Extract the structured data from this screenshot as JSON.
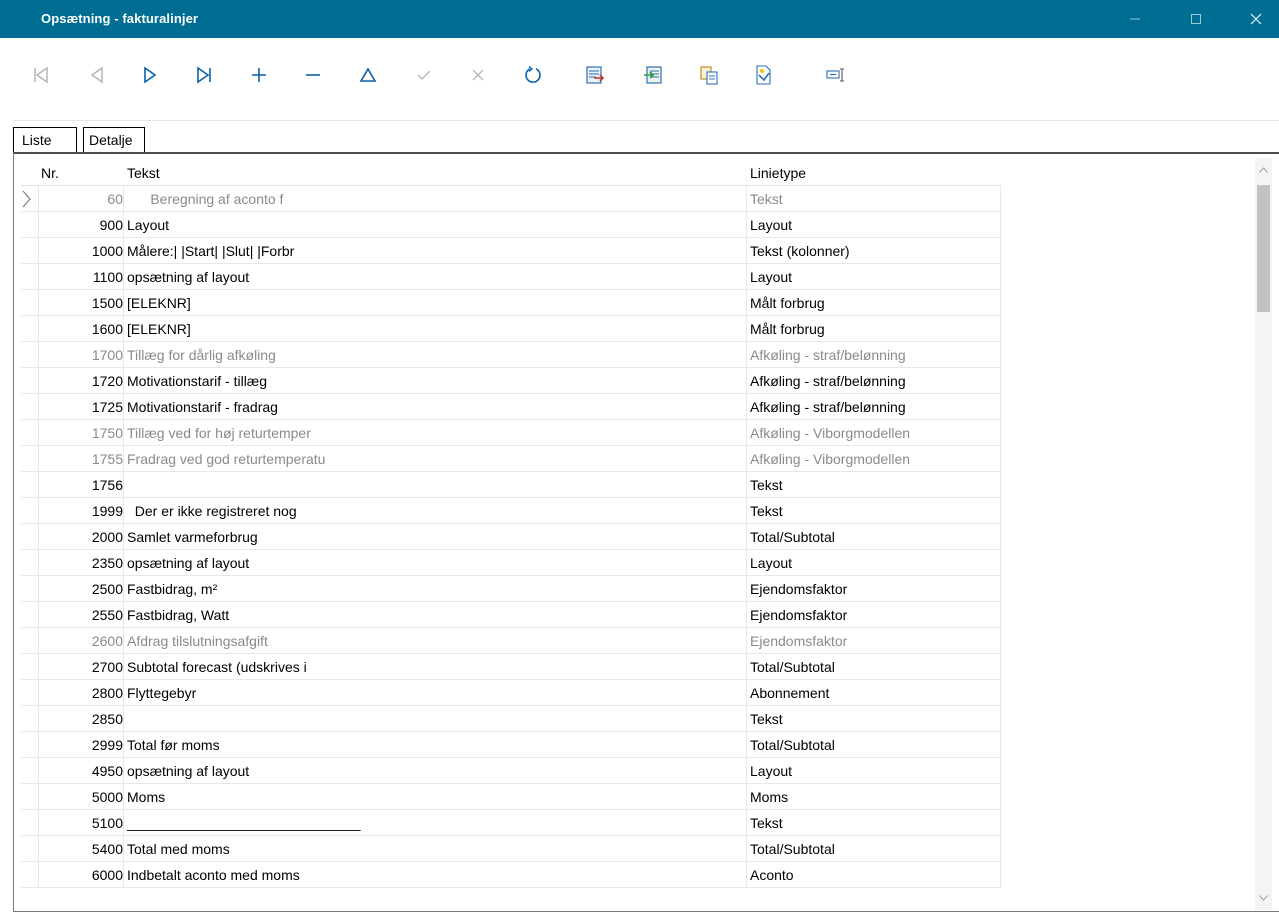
{
  "window": {
    "title": "Opsætning - fakturalinjer",
    "minimize": "—",
    "maximize": "☐",
    "close": "✕"
  },
  "toolbar": {
    "buttons": [
      {
        "name": "first-record",
        "icon": "first-icon",
        "enabled": false
      },
      {
        "name": "prior-record",
        "icon": "prior-icon",
        "enabled": false
      },
      {
        "name": "next-record",
        "icon": "next-icon",
        "enabled": true
      },
      {
        "name": "last-record",
        "icon": "last-icon",
        "enabled": true
      },
      {
        "name": "insert-record",
        "icon": "plus-icon",
        "enabled": true
      },
      {
        "name": "delete-record",
        "icon": "minus-icon",
        "enabled": true
      },
      {
        "name": "edit-record",
        "icon": "triangle-icon",
        "enabled": true
      },
      {
        "name": "post-edit",
        "icon": "check-icon",
        "enabled": false
      },
      {
        "name": "cancel-edit",
        "icon": "x-icon",
        "enabled": false
      },
      {
        "name": "refresh",
        "icon": "refresh-icon",
        "enabled": true
      },
      {
        "name": "export",
        "icon": "export-icon",
        "enabled": true
      },
      {
        "name": "import",
        "icon": "import-icon",
        "enabled": true
      },
      {
        "name": "copy",
        "icon": "copy-icon",
        "enabled": true
      },
      {
        "name": "edit-document",
        "icon": "document-edit-icon",
        "enabled": true
      },
      {
        "name": "field-chooser",
        "icon": "columns-icon",
        "enabled": true
      }
    ]
  },
  "tabs": [
    {
      "label": "Liste",
      "active": true
    },
    {
      "label": "Detalje",
      "active": false
    }
  ],
  "grid": {
    "columns": {
      "nr": "Nr.",
      "tekst": "Tekst",
      "linietype": "Linietype"
    },
    "rows": [
      {
        "nr": "60",
        "tekst": "      Beregning af aconto f",
        "linietype": "Tekst",
        "dim": true,
        "selected": true
      },
      {
        "nr": "900",
        "tekst": "Layout",
        "linietype": "Layout",
        "dim": false
      },
      {
        "nr": "1000",
        "tekst": "Målere:| |Start| |Slut| |Forbr",
        "linietype": "Tekst (kolonner)",
        "dim": false
      },
      {
        "nr": "1100",
        "tekst": "opsætning af layout",
        "linietype": "Layout",
        "dim": false
      },
      {
        "nr": "1500",
        "tekst": "[ELEKNR]",
        "linietype": "Målt forbrug",
        "dim": false
      },
      {
        "nr": "1600",
        "tekst": "[ELEKNR]",
        "linietype": "Målt forbrug",
        "dim": false
      },
      {
        "nr": "1700",
        "tekst": "Tillæg for dårlig afkøling",
        "linietype": "Afkøling - straf/belønning",
        "dim": true
      },
      {
        "nr": "1720",
        "tekst": "Motivationstarif - tillæg",
        "linietype": "Afkøling - straf/belønning",
        "dim": false
      },
      {
        "nr": "1725",
        "tekst": "Motivationstarif - fradrag",
        "linietype": "Afkøling - straf/belønning",
        "dim": false
      },
      {
        "nr": "1750",
        "tekst": "Tillæg ved for høj returtemper",
        "linietype": "Afkøling - Viborgmodellen",
        "dim": true
      },
      {
        "nr": "1755",
        "tekst": "Fradrag ved god returtemperatu",
        "linietype": "Afkøling - Viborgmodellen",
        "dim": true
      },
      {
        "nr": "1756",
        "tekst": "",
        "linietype": "Tekst",
        "dim": false
      },
      {
        "nr": "1999",
        "tekst": "  Der er ikke registreret nog",
        "linietype": "Tekst",
        "dim": false
      },
      {
        "nr": "2000",
        "tekst": "Samlet varmeforbrug",
        "linietype": "Total/Subtotal",
        "dim": false
      },
      {
        "nr": "2350",
        "tekst": "opsætning af layout",
        "linietype": "Layout",
        "dim": false
      },
      {
        "nr": "2500",
        "tekst": "Fastbidrag, m²",
        "linietype": "Ejendomsfaktor",
        "dim": false
      },
      {
        "nr": "2550",
        "tekst": "Fastbidrag, Watt",
        "linietype": "Ejendomsfaktor",
        "dim": false
      },
      {
        "nr": "2600",
        "tekst": "Afdrag tilslutningsafgift",
        "linietype": "Ejendomsfaktor",
        "dim": true
      },
      {
        "nr": "2700",
        "tekst": "Subtotal forecast (udskrives i",
        "linietype": "Total/Subtotal",
        "dim": false
      },
      {
        "nr": "2800",
        "tekst": "Flyttegebyr",
        "linietype": "Abonnement",
        "dim": false
      },
      {
        "nr": "2850",
        "tekst": "",
        "linietype": "Tekst",
        "dim": false
      },
      {
        "nr": "2999",
        "tekst": "Total før moms",
        "linietype": "Total/Subtotal",
        "dim": false
      },
      {
        "nr": "4950",
        "tekst": "opsætning af layout",
        "linietype": "Layout",
        "dim": false
      },
      {
        "nr": "5000",
        "tekst": "Moms",
        "linietype": "Moms",
        "dim": false
      },
      {
        "nr": "5100",
        "tekst": "______________________________",
        "linietype": "Tekst",
        "dim": false
      },
      {
        "nr": "5400",
        "tekst": "Total med moms",
        "linietype": "Total/Subtotal",
        "dim": false
      },
      {
        "nr": "6000",
        "tekst": "Indbetalt aconto med moms",
        "linietype": "Aconto",
        "dim": false
      }
    ]
  },
  "scrollbar": {
    "up": "▲",
    "down": "▼"
  },
  "colors": {
    "titlebar": "#006d93",
    "dim_text": "#8a8a8a",
    "icon_blue": "#0a62a8",
    "icon_disabled": "#b5b5b5"
  }
}
